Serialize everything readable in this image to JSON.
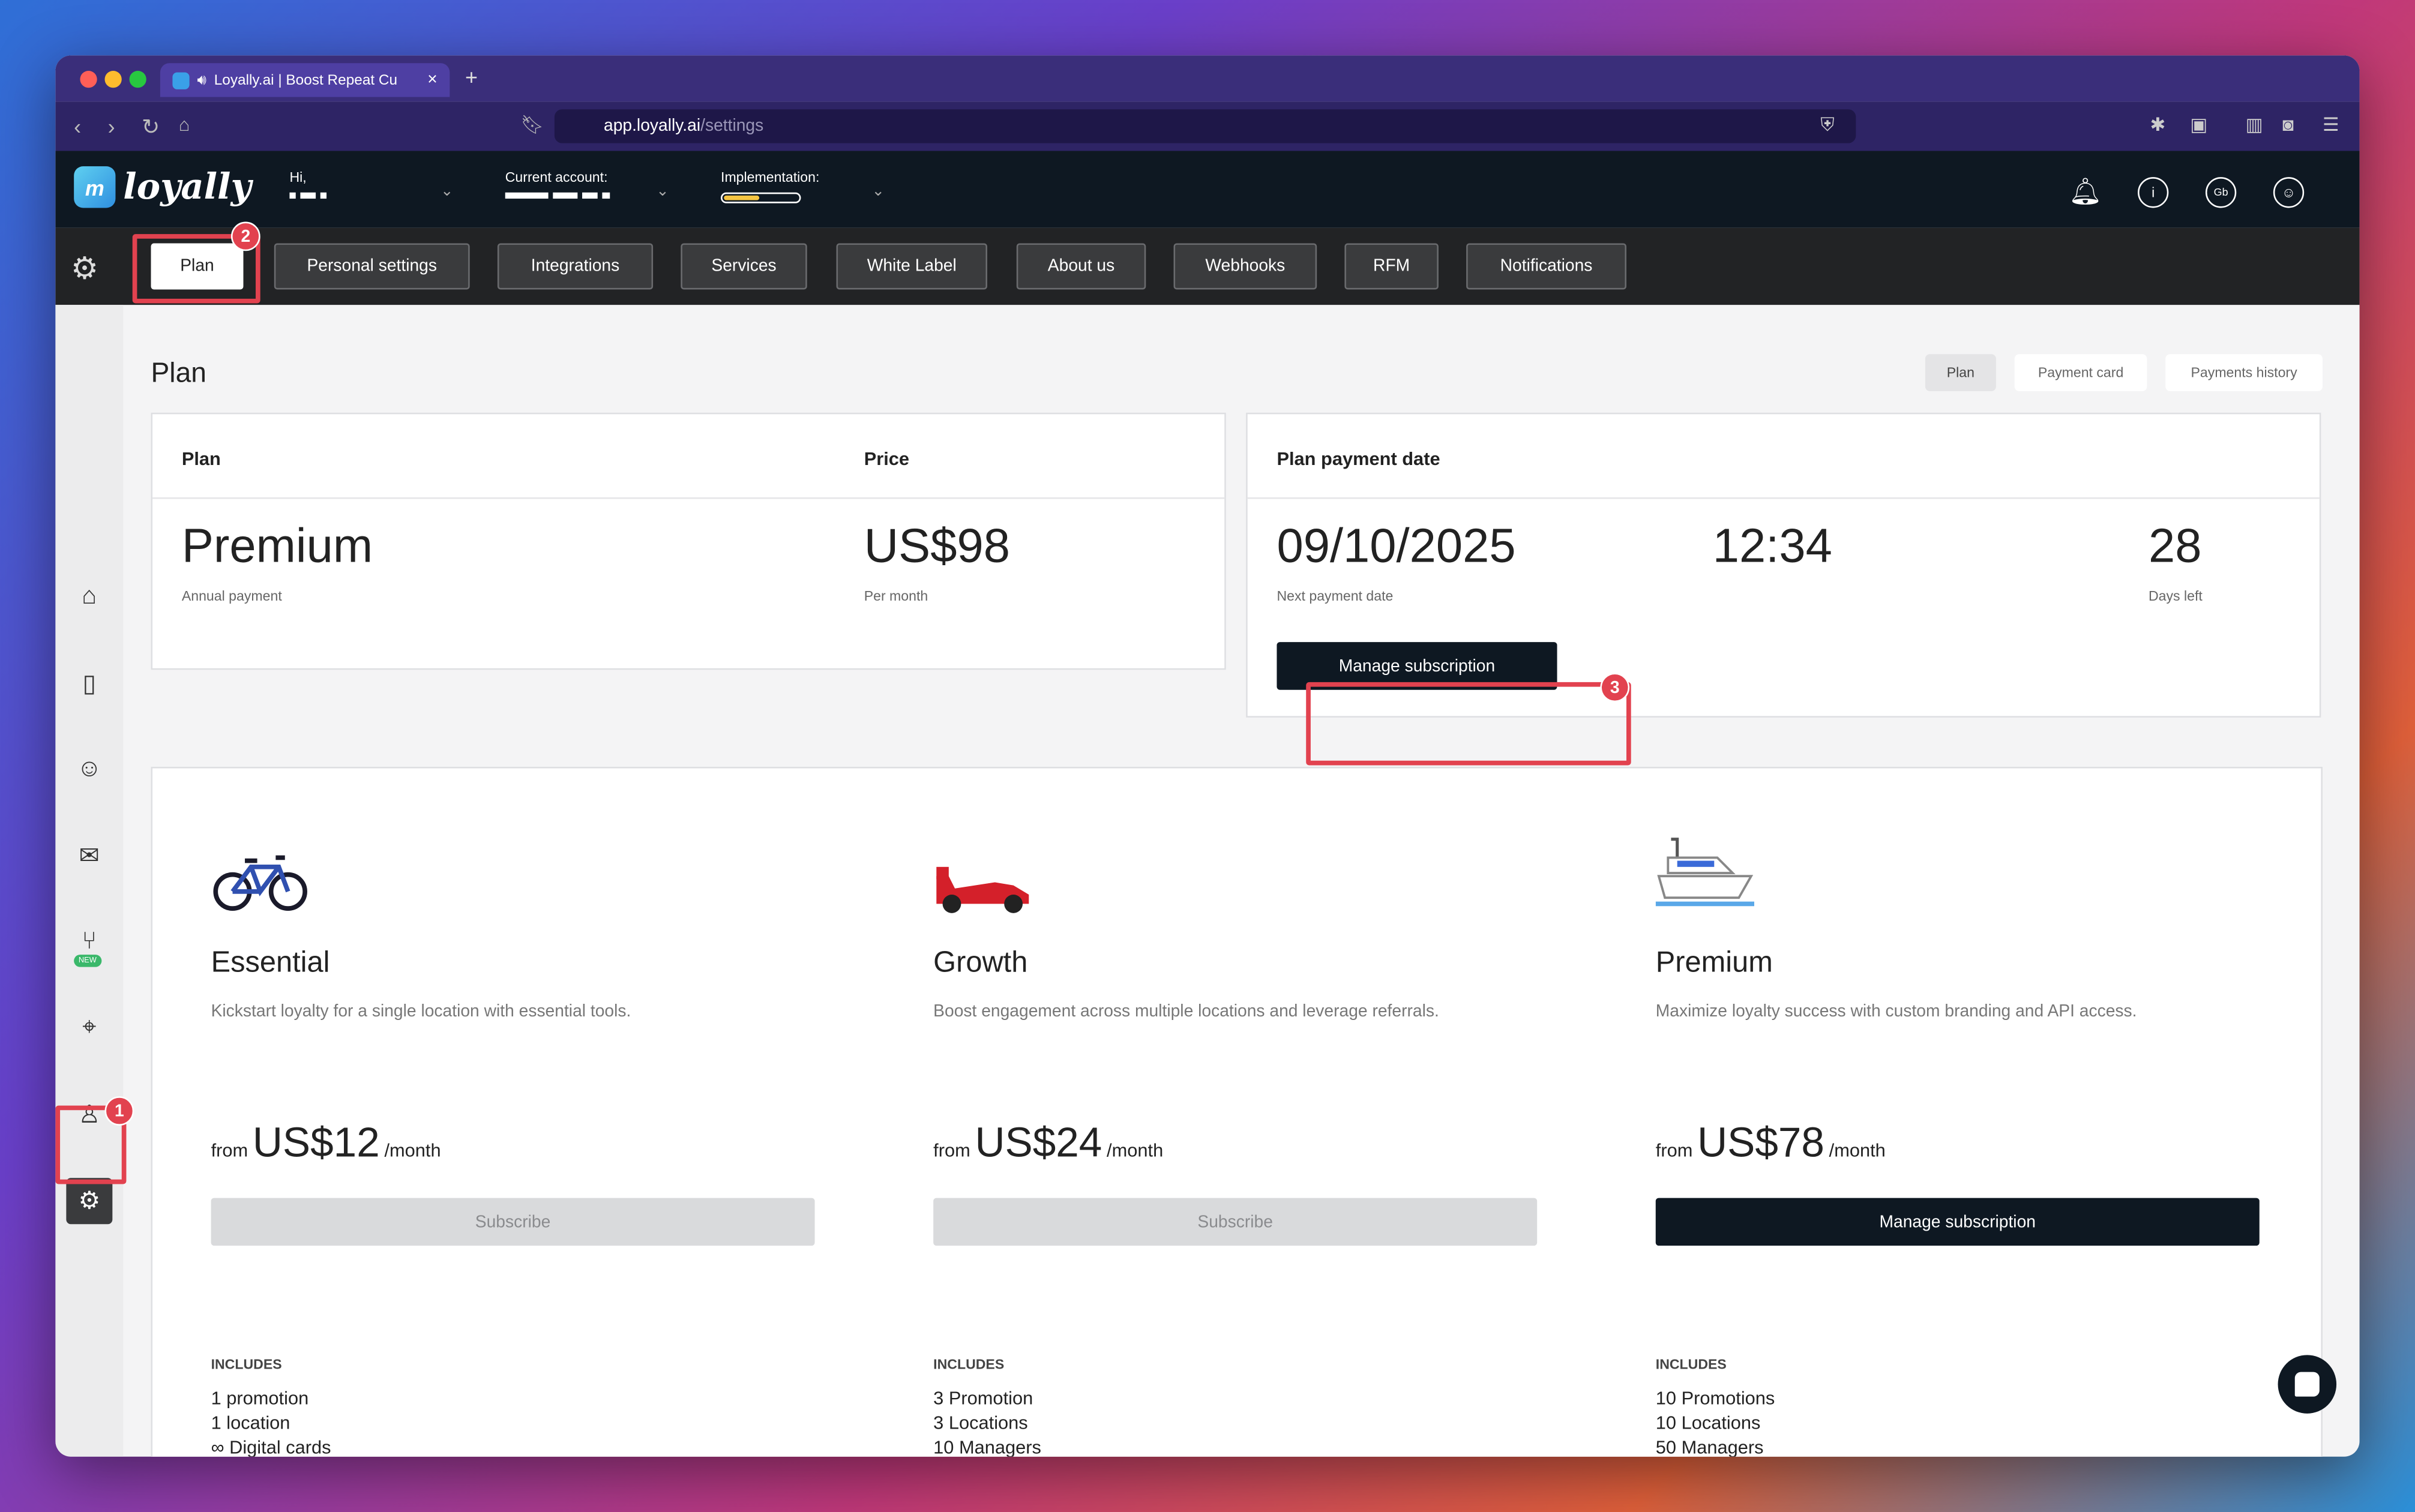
{
  "browser": {
    "tab_title": "Loyally.ai | Boost Repeat Cu",
    "tab_audio_icon": "speaker-icon",
    "tab_close": "×",
    "new_tab": "+",
    "url_host": "app.loyally.ai",
    "url_path": "/settings"
  },
  "header": {
    "brand": "loyally",
    "brand_mark": "m",
    "greeting_label": "Hi,",
    "account_label": "Current account:",
    "implementation_label": "Implementation:",
    "implementation_progress": 0.45,
    "avatar_initials": "Gb",
    "info_icon": "i"
  },
  "settings_tabs": [
    {
      "label": "Plan",
      "active": true
    },
    {
      "label": "Personal settings"
    },
    {
      "label": "Integrations"
    },
    {
      "label": "Services"
    },
    {
      "label": "White Label"
    },
    {
      "label": "About us"
    },
    {
      "label": "Webhooks"
    },
    {
      "label": "RFM"
    },
    {
      "label": "Notifications"
    }
  ],
  "annotations": [
    "1",
    "2",
    "3"
  ],
  "page": {
    "title": "Plan",
    "subtabs": [
      {
        "label": "Plan",
        "active": true
      },
      {
        "label": "Payment card"
      },
      {
        "label": "Payments history"
      }
    ]
  },
  "plan_card": {
    "plan_header": "Plan",
    "price_header": "Price",
    "plan_name": "Premium",
    "plan_sub": "Annual payment",
    "price": "US$98",
    "price_sub": "Per month"
  },
  "payment_card": {
    "header": "Plan payment date",
    "date": "09/10/2025",
    "date_sub": "Next payment date",
    "time": "12:34",
    "days": "28",
    "days_sub": "Days left",
    "button": "Manage subscription"
  },
  "plans": [
    {
      "icon": "bicycle-icon",
      "name": "Essential",
      "desc": "Kickstart loyalty for a single location with essential tools.",
      "from": "from",
      "price": "US$12",
      "per": "/month",
      "button": "Subscribe",
      "includes": "INCLUDES",
      "items": [
        "1 promotion",
        "1 location",
        "∞ Digital cards"
      ]
    },
    {
      "icon": "race-car-icon",
      "name": "Growth",
      "desc": "Boost engagement across multiple locations and leverage referrals.",
      "from": "from",
      "price": "US$24",
      "per": "/month",
      "button": "Subscribe",
      "includes": "INCLUDES",
      "items": [
        "3 Promotion",
        "3 Locations",
        "10 Managers"
      ]
    },
    {
      "icon": "yacht-icon",
      "name": "Premium",
      "desc": "Maximize loyalty success with custom branding and API access.",
      "from": "from",
      "price": "US$78",
      "per": "/month",
      "button": "Manage subscription",
      "includes": "INCLUDES",
      "items": [
        "10 Promotions",
        "10 Locations",
        "50 Managers"
      ]
    }
  ],
  "colors": {
    "accent": "#e2424f",
    "dark": "#0e1822",
    "browser": "#3a2e7a"
  }
}
